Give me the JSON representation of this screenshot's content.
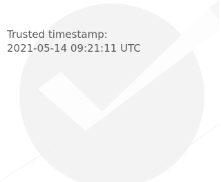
{
  "timestamp": {
    "label": "Trusted timestamp:",
    "value": "2021-05-14 09:21:11 UTC"
  },
  "watermark": {
    "icon": "checkmark-icon",
    "circle_color": "#f3f3f3",
    "check_color": "#fdfdfd"
  },
  "text_color": "#5a5a5a"
}
